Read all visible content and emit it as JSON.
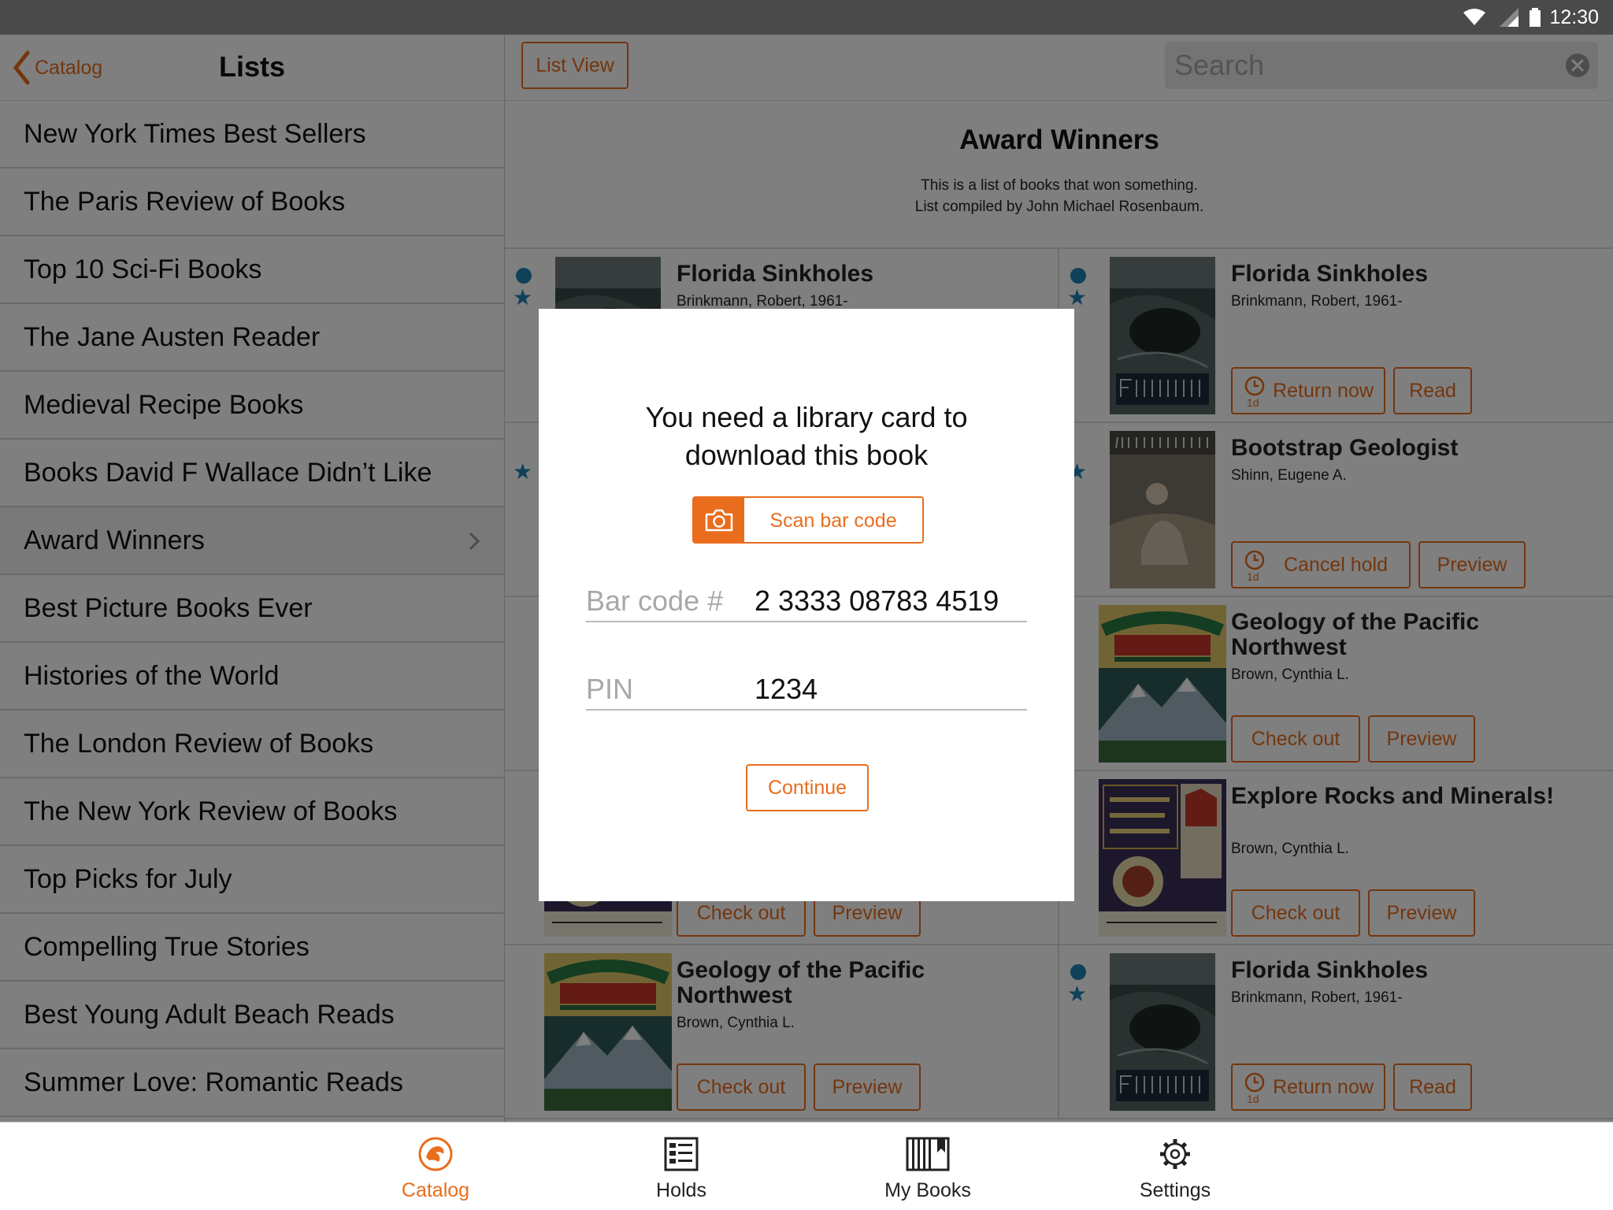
{
  "status_bar": {
    "time": "12:30",
    "icons": [
      "wifi-icon",
      "signal-icon",
      "battery-icon"
    ]
  },
  "left_header": {
    "back_label": "Catalog",
    "title": "Lists"
  },
  "lists": [
    {
      "label": "New York Times Best Sellers"
    },
    {
      "label": "The Paris Review of Books"
    },
    {
      "label": "Top 10 Sci-Fi Books"
    },
    {
      "label": "The Jane Austen Reader"
    },
    {
      "label": "Medieval Recipe Books"
    },
    {
      "label": "Books David F Wallace Didn’t Like"
    },
    {
      "label": "Award Winners",
      "selected": true
    },
    {
      "label": "Best Picture Books Ever"
    },
    {
      "label": "Histories of the World"
    },
    {
      "label": "The London Review of Books"
    },
    {
      "label": "The New York Review of Books"
    },
    {
      "label": "Top Picks for July"
    },
    {
      "label": "Compelling True Stories"
    },
    {
      "label": "Best Young Adult Beach Reads"
    },
    {
      "label": "Summer Love: Romantic Reads"
    }
  ],
  "right_header": {
    "list_view_label": "List View",
    "search_placeholder": "Search"
  },
  "list_detail": {
    "title": "Award Winners",
    "description_line1": "This is a list of books that won something.",
    "description_line2": "List compiled by John Michael Rosenbaum."
  },
  "books": [
    {
      "title": "Florida Sinkholes",
      "author": "Brinkmann, Robert, 1961-",
      "buttons": []
    },
    {
      "title": "Florida Sinkholes",
      "author": "Brinkmann, Robert, 1961-",
      "loan_badge": "1d",
      "buttons": [
        "Return now",
        "Read"
      ]
    },
    {
      "title": "Bootstrap Geologist",
      "author": "Shinn, Eugene A.",
      "loan_badge": "1d",
      "buttons": [
        "Cancel hold",
        "Preview"
      ]
    },
    {
      "title": "Geology of the Pacific Northwest",
      "author": "Brown, Cynthia L.",
      "buttons": [
        "Check out",
        "Preview"
      ]
    },
    {
      "title": "Explore Rocks and Minerals!",
      "author": "Brown, Cynthia L.",
      "buttons": [
        "Check out",
        "Preview"
      ]
    },
    {
      "title": "",
      "author": "",
      "buttons": [
        "Check out",
        "Preview"
      ]
    },
    {
      "title": "Geology of the Pacific Northwest",
      "author": "Brown, Cynthia L.",
      "buttons": [
        "Check out",
        "Preview"
      ]
    },
    {
      "title": "Florida Sinkholes",
      "author": "Brinkmann, Robert, 1961-",
      "loan_badge": "1d",
      "buttons": [
        "Return now",
        "Read"
      ]
    }
  ],
  "modal": {
    "title_line1": "You need a library card to",
    "title_line2": "download this book",
    "scan_label": "Scan bar code",
    "barcode_label": "Bar code #",
    "barcode_value": "2 3333 08783 4519",
    "pin_label": "PIN",
    "pin_value": "1234",
    "continue_label": "Continue"
  },
  "tabs": [
    {
      "label": "Catalog",
      "icon": "catalog-logo-icon",
      "active": true
    },
    {
      "label": "Holds",
      "icon": "holds-icon"
    },
    {
      "label": "My Books",
      "icon": "my-books-icon"
    },
    {
      "label": "Settings",
      "icon": "gear-icon"
    }
  ],
  "colors": {
    "accent": "#e96d1d",
    "indicator": "#1e82b4",
    "overlay": "rgba(0,0,0,0.5)"
  }
}
